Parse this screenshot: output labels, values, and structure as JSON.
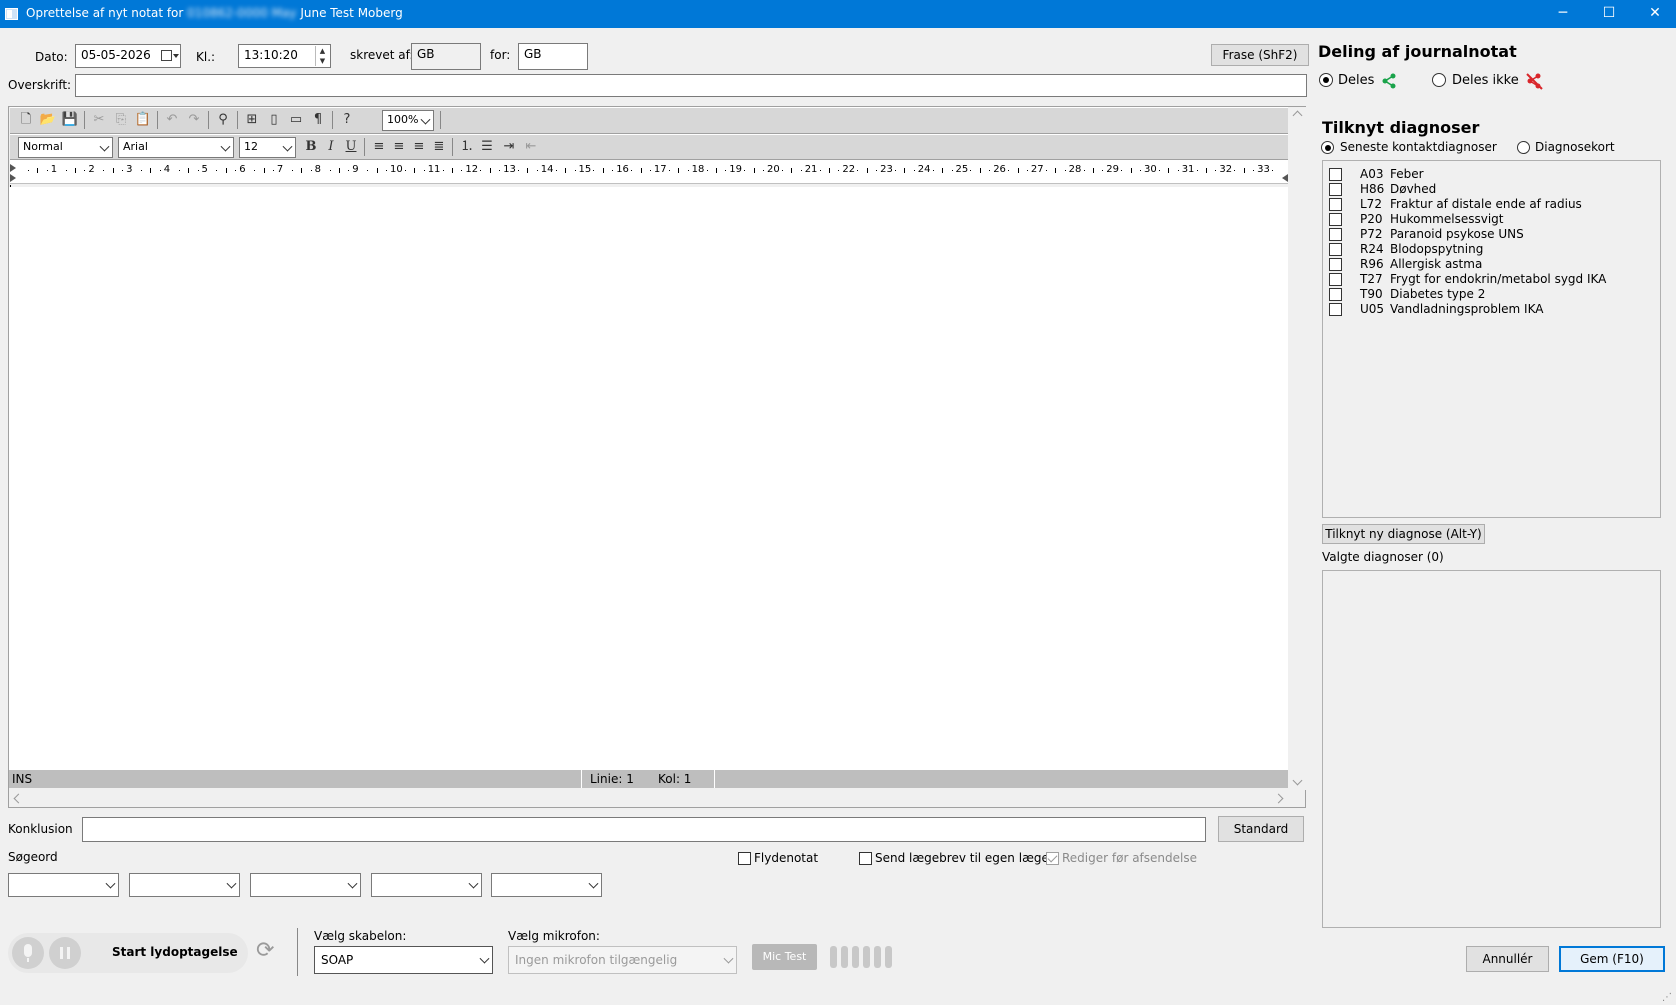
{
  "window": {
    "title_prefix": "Oprettelse af nyt notat for",
    "title_patient_id": "010862-0000 May",
    "title_patient_name": "June Test Moberg",
    "minimize": "─",
    "maximize": "☐",
    "close": "✕"
  },
  "header": {
    "date_label": "Dato:",
    "date_value": "05-05-2026",
    "time_label": "Kl.:",
    "time_value": "13:10:20",
    "written_by_label": "skrevet af:",
    "written_by_value": "GB",
    "for_label": "for:",
    "for_value": "GB",
    "frase_button": "Frase (ShF2)",
    "heading_label": "Overskrift:",
    "heading_value": ""
  },
  "editor": {
    "zoom": "100%",
    "style": "Normal",
    "font": "Arial",
    "size": "12",
    "bold": "B",
    "italic": "I",
    "underline": "U",
    "ruler_numbers": [
      "1",
      "2",
      "3",
      "4",
      "5",
      "6",
      "7",
      "8",
      "9",
      "10",
      "11",
      "12",
      "13",
      "14",
      "15",
      "16",
      "17",
      "18",
      "19",
      "20",
      "21",
      "22",
      "23",
      "24",
      "25",
      "26",
      "27",
      "28",
      "29",
      "30",
      "31",
      "32",
      "33"
    ],
    "status_mode": "INS",
    "status_line": "Linie: 1",
    "status_col": "Kol: 1"
  },
  "bottom": {
    "konklusion_label": "Konklusion",
    "konklusion_value": "",
    "standard_button": "Standard",
    "soegeord_label": "Søgeord",
    "flydenotat_label": "Flydenotat",
    "send_label": "Send lægebrev til egen læge",
    "rediger_label": "Rediger før afsendelse",
    "start_record": "Start lydoptagelse",
    "template_label": "Vælg skabelon:",
    "template_value": "SOAP",
    "mic_label": "Vælg mikrofon:",
    "mic_value": "Ingen mikrofon tilgængelig",
    "mic_test": "Mic Test"
  },
  "sharing": {
    "title": "Deling af journalnotat",
    "share_yes": "Deles",
    "share_no": "Deles ikke"
  },
  "diagnoses": {
    "title": "Tilknyt diagnoser",
    "opt_latest": "Seneste kontaktdiagnoser",
    "opt_card": "Diagnosekort",
    "items": [
      {
        "code": "A03",
        "name": "Feber"
      },
      {
        "code": "H86",
        "name": "Døvhed"
      },
      {
        "code": "L72",
        "name": "Fraktur af distale ende af radius"
      },
      {
        "code": "P20",
        "name": "Hukommelsessvigt"
      },
      {
        "code": "P72",
        "name": "Paranoid psykose UNS"
      },
      {
        "code": "R24",
        "name": "Blodopspytning"
      },
      {
        "code": "R96",
        "name": "Allergisk astma"
      },
      {
        "code": "T27",
        "name": "Frygt for endokrin/metabol sygd IKA"
      },
      {
        "code": "T90",
        "name": "Diabetes type 2"
      },
      {
        "code": "U05",
        "name": "Vandladningsproblem IKA"
      }
    ],
    "add_button": "Tilknyt ny diagnose (Alt-Y)",
    "selected_label": "Valgte diagnoser (0)"
  },
  "actions": {
    "cancel": "Annullér",
    "save": "Gem (F10)"
  },
  "colors": {
    "titlebar": "#0078d7",
    "share_icon": "#1aa34a",
    "noshare_icon": "#d9262b"
  }
}
